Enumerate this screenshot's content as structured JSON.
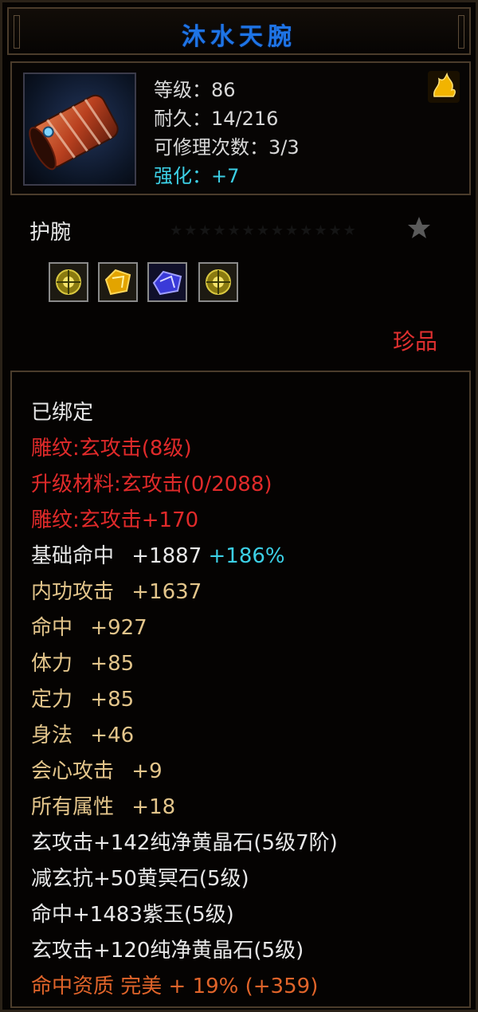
{
  "item": {
    "name": "沐水天腕",
    "icon": "bracer-icon",
    "stats": {
      "level": "等级：86",
      "durability": "耐久：14/216",
      "repair_count": "可修理次数：3/3",
      "enhance": "强化：+7"
    },
    "type_label": "护腕",
    "quality": "珍品",
    "slots": [
      "yellow-gem-icon",
      "gold-gem-icon",
      "purple-gem-icon",
      "yellow-gem-icon"
    ]
  },
  "attributes": {
    "bound": "已绑定",
    "engrave": "雕纹:玄攻击(8级)",
    "upgrade_material": "升级材料:玄攻击(0/2088)",
    "engrave_bonus": "雕纹:玄攻击+170",
    "base_hit_label": "基础命中",
    "base_hit_value": "+1887",
    "base_hit_pct": "+186%",
    "internal_attack_label": "内功攻击",
    "internal_attack_value": "+1637",
    "hit_label": "命中",
    "hit_value": "+927",
    "stamina_label": "体力",
    "stamina_value": "+85",
    "focus_label": "定力",
    "focus_value": "+85",
    "agility_label": "身法",
    "agility_value": "+46",
    "crit_label": "会心攻击",
    "crit_value": "+9",
    "all_attr_label": "所有属性",
    "all_attr_value": "+18",
    "gem1": "玄攻击+142纯净黄晶石(5级7阶)",
    "gem2": "减玄抗+50黄冥石(5级)",
    "gem3": "命中+1483紫玉(5级)",
    "gem4": "玄攻击+120纯净黄晶石(5级)",
    "aptitude": "命中资质 完美 + 19% (+359)"
  },
  "colors": {
    "title": "#1e74e6",
    "red": "#e02a2a",
    "gold": "#e3c58b",
    "cyan": "#3cd0e6",
    "orange": "#e0642a"
  }
}
